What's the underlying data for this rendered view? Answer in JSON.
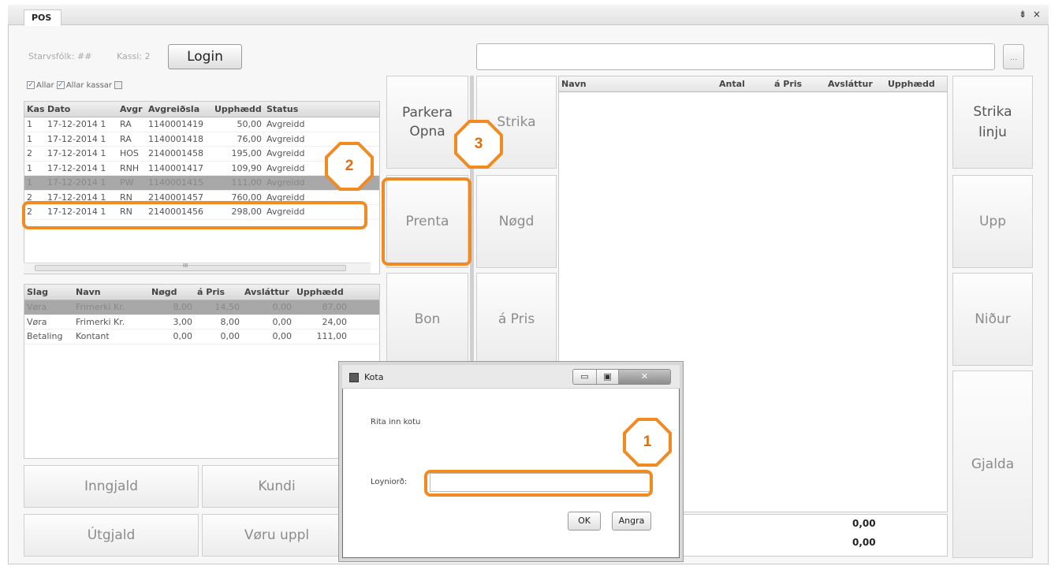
{
  "window": {
    "tab": "POS",
    "controls": "⇟ ×"
  },
  "top": {
    "staff_label": "Starvsfólk: ##",
    "till_label": "Kassi: 2",
    "login": "Login",
    "ellipsis": "..."
  },
  "filters": {
    "all": "Allar",
    "all_tills": "Allar kassar"
  },
  "receipts": {
    "columns": [
      "Kassi",
      "Dato",
      "Avgr",
      "Avgreiðsla",
      "Upphædd",
      "Status"
    ],
    "rows": [
      [
        "1",
        "17-12-2014 1",
        "RA",
        "1140001419",
        "50,00",
        "Avgreidd"
      ],
      [
        "1",
        "17-12-2014 1",
        "RA",
        "1140001418",
        "76,00",
        "Avgreidd"
      ],
      [
        "2",
        "17-12-2014 1",
        "HOS",
        "2140001458",
        "195,00",
        "Avgreidd"
      ],
      [
        "1",
        "17-12-2014 1",
        "RNH",
        "1140001417",
        "109,90",
        "Avgreidd"
      ],
      [
        "1",
        "17-12-2014 1",
        "PW",
        "1140001415",
        "111,00",
        "Avgreidd"
      ],
      [
        "2",
        "17-12-2014 1",
        "RN",
        "2140001457",
        "760,00",
        "Avgreidd"
      ],
      [
        "2",
        "17-12-2014 1",
        "RN",
        "2140001456",
        "298,00",
        "Avgreidd"
      ]
    ],
    "scroll_mark": "III"
  },
  "lines": {
    "columns": [
      "Slag",
      "Navn",
      "Nøgd",
      "á Pris",
      "Avsláttur",
      "Upphædd"
    ],
    "rows": [
      [
        "Vøra",
        "Frimerki Kr.",
        "8,00",
        "14,50",
        "0,00",
        "87,00"
      ],
      [
        "Vøra",
        "Frimerki Kr.",
        "3,00",
        "8,00",
        "0,00",
        "24,00"
      ],
      [
        "Betaling",
        "Kontant",
        "0,00",
        "0,00",
        "0,00",
        "111,00"
      ]
    ]
  },
  "bottom_buttons": {
    "inngjald": "Inngjald",
    "kundi": "Kundi",
    "utgjald": "Útgjald",
    "voru_uppl": "Vøru uppl"
  },
  "mid_buttons": {
    "parkera": "Parkera Opna",
    "prenta": "Prenta",
    "bon": "Bon",
    "strika": "Strika",
    "nogd": "Nøgd",
    "a_pris": "á Pris"
  },
  "cart": {
    "columns": [
      "Navn",
      "Antal",
      "á Pris",
      "Avsláttur",
      "Upphædd"
    ],
    "total1": "0,00",
    "total2": "0,00"
  },
  "right_buttons": {
    "strika_linju": "Strika linju",
    "upp": "Upp",
    "nidur": "Niður",
    "gjalda": "Gjalda"
  },
  "dialog": {
    "title": "Kota",
    "prompt": "Rita inn kotu",
    "field_label": "Loyniorð:",
    "ok": "OK",
    "cancel": "Angra"
  },
  "annotations": {
    "step1": "1",
    "step2": "2",
    "step3": "3"
  },
  "colors": {
    "annotation": "#f28a22",
    "selected_row": "#a8a8a8"
  }
}
